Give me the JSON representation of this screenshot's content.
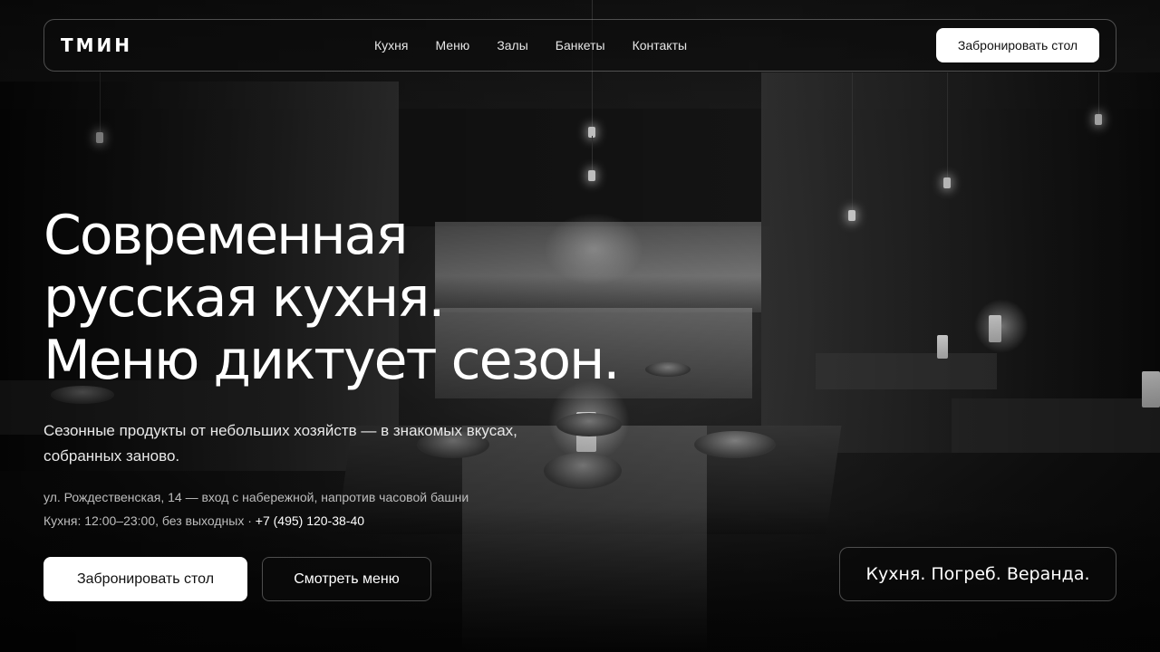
{
  "header": {
    "logo": "ТМИН",
    "nav": [
      {
        "label": "Кухня"
      },
      {
        "label": "Меню"
      },
      {
        "label": "Залы"
      },
      {
        "label": "Банкеты"
      },
      {
        "label": "Контакты"
      }
    ],
    "cta_label": "Забронировать стол"
  },
  "hero": {
    "title_lines": [
      "Современная",
      "русская кухня.",
      "Меню диктует сезон."
    ],
    "subtitle": "Сезонные продукты от небольших хозяйств — в знакомых вкусах, собранных заново.",
    "address": "ул. Рождественская, 14 — вход с набережной, напротив часовой башни",
    "hours": "Кухня: 12:00–23:00, без выходных · ",
    "phone": "+7 (495) 120-38-40",
    "primary_button": "Забронировать стол",
    "secondary_button": "Смотреть меню",
    "tagline": "Кухня. Погреб. Веранда."
  },
  "colors": {
    "background": "#0b0b0b",
    "text": "#ffffff",
    "muted_text": "#bdbdbd",
    "button_bg": "#ffffff",
    "button_text": "#111111"
  }
}
